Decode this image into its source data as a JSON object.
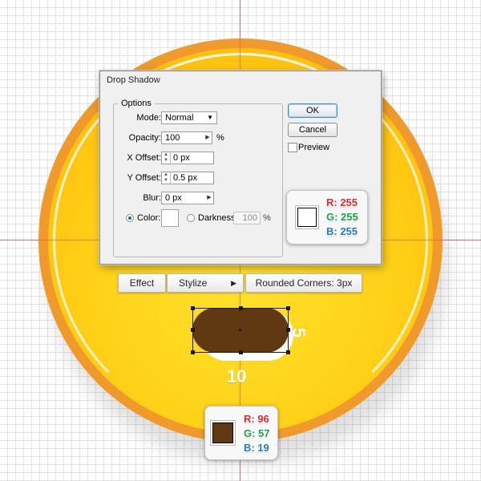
{
  "dialog": {
    "title": "Drop Shadow",
    "options_group": "Options",
    "mode_label": "Mode:",
    "mode_value": "Normal",
    "opacity_label": "Opacity:",
    "opacity_value": "100",
    "opacity_unit": "%",
    "x_offset_label": "X Offset:",
    "x_offset_value": "0 px",
    "y_offset_label": "Y Offset:",
    "y_offset_value": "0.5 px",
    "blur_label": "Blur:",
    "blur_value": "0 px",
    "color_label": "Color:",
    "darkness_label": "Darkness:",
    "darkness_value": "100",
    "darkness_unit": "%",
    "ok_label": "OK",
    "cancel_label": "Cancel",
    "preview_label": "Preview"
  },
  "shadow_color": {
    "r": "R: 255",
    "g": "G: 255",
    "b": "B: 255",
    "hex": "#ffffff"
  },
  "mouth_color": {
    "r": "R: 96",
    "g": "G: 57",
    "b": "B: 19",
    "hex": "#603913"
  },
  "breadcrumb": {
    "effect": "Effect",
    "stylize": "Stylize",
    "rounded": "Rounded Corners: 3px"
  },
  "dimensions": {
    "width": "10",
    "height": "5"
  },
  "colors": {
    "red_text": "#e0282e",
    "green_text": "#16a34a",
    "blue_text": "#1f7bc4",
    "face_rim": "#ef9a2a",
    "face_fill": "#ffd21a"
  }
}
